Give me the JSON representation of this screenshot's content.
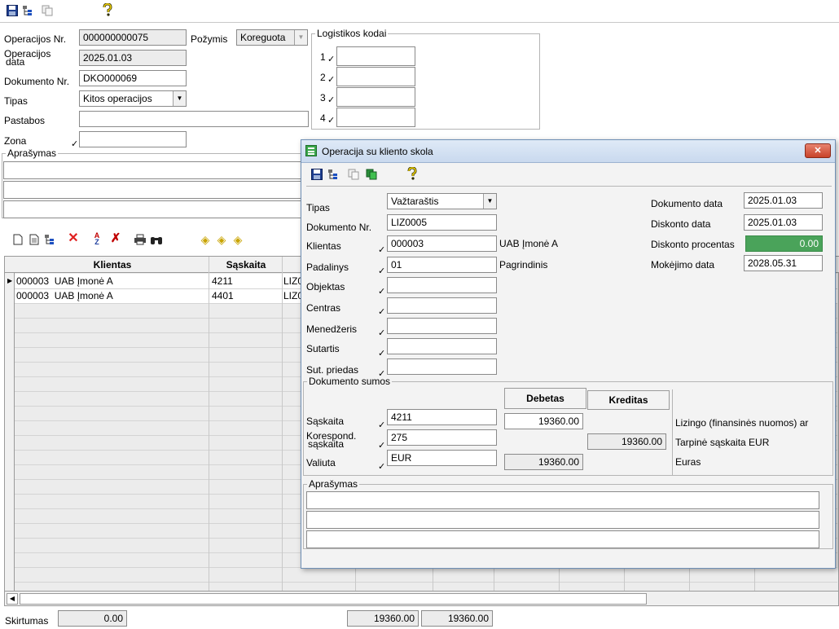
{
  "toolbar": {
    "icons": [
      "save-icon",
      "tree-icon",
      "copy-icon",
      "help-icon"
    ]
  },
  "main": {
    "op_nr_label": "Operacijos Nr.",
    "op_nr_value": "000000000075",
    "pozymis_label": "Požymis",
    "pozymis_value": "Koreguota",
    "op_data_label_1": "Operacijos",
    "op_data_label_2": "data",
    "op_data_value": "2025.01.03",
    "dok_nr_label": "Dokumento Nr.",
    "dok_nr_value": "DKO000069",
    "tipas_label": "Tipas",
    "tipas_value": "Kitos operacijos",
    "pastabos_label": "Pastabos",
    "zona_label": "Zona",
    "aprasymas_label": "Aprašymas",
    "logistikos_title": "Logistikos kodai",
    "logistikos_rows": [
      "1",
      "2",
      "3",
      "4"
    ]
  },
  "grid": {
    "columns": [
      "Klientas",
      "Sąskaita"
    ],
    "rows": [
      {
        "klientas": "000003  UAB Įmonė A",
        "saskaita": "4211",
        "extra": "LIZ0"
      },
      {
        "klientas": "000003  UAB Įmonė A",
        "saskaita": "4401",
        "extra": "LIZ0"
      }
    ]
  },
  "footer": {
    "skirtumas_label": "Skirtumas",
    "skirtumas_value": "0.00",
    "debet_total": "19360.00",
    "kredit_total": "19360.00"
  },
  "dialog": {
    "title": "Operacija su kliento skola",
    "close_label": "✕",
    "tipas_label": "Tipas",
    "tipas_value": "Važtaraštis",
    "dok_nr_label": "Dokumento Nr.",
    "dok_nr_value": "LIZ0005",
    "klientas_label": "Klientas",
    "klientas_value": "000003",
    "klientas_name": "UAB Įmonė A",
    "padalinys_label": "Padalinys",
    "padalinys_value": "01",
    "padalinys_name": "Pagrindinis",
    "objektas_label": "Objektas",
    "centras_label": "Centras",
    "menedzeris_label": "Menedžeris",
    "sutartis_label": "Sutartis",
    "sut_priedas_label": "Sut. priedas",
    "dok_data_label": "Dokumento data",
    "dok_data_value": "2025.01.03",
    "disk_data_label": "Diskonto data",
    "disk_data_value": "2025.01.03",
    "disk_proc_label": "Diskonto procentas",
    "disk_proc_value": "0.00",
    "mok_data_label": "Mokėjimo data",
    "mok_data_value": "2028.05.31",
    "sumos_title": "Dokumento sumos",
    "debetas_label": "Debetas",
    "kreditas_label": "Kreditas",
    "saskaita_label": "Sąskaita",
    "saskaita_value": "4211",
    "saskaita_debet": "19360.00",
    "saskaita_desc": "Lizingo (finansinės nuomos) ar",
    "koresp_label_1": "Korespond.",
    "koresp_label_2": "sąskaita",
    "koresp_value": "275",
    "koresp_kredit": "19360.00",
    "koresp_desc": "Tarpinė sąskaita EUR",
    "valiuta_label": "Valiuta",
    "valiuta_value": "EUR",
    "valiuta_debet": "19360.00",
    "valiuta_desc": "Euras",
    "aprasymas_label": "Aprašymas"
  }
}
